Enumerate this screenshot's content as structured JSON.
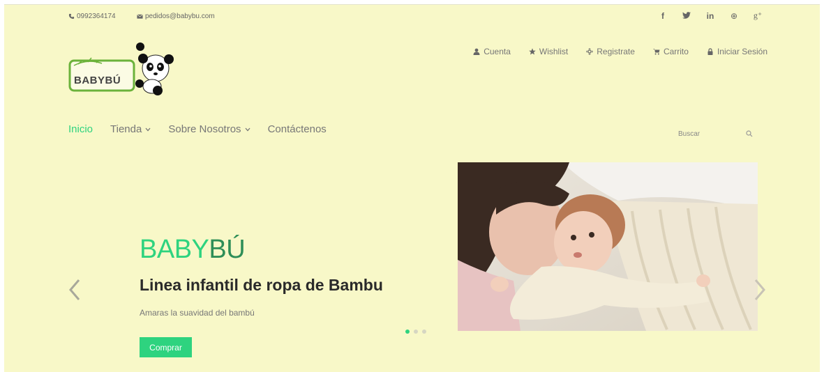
{
  "topbar": {
    "phone": "0992364174",
    "email": "pedidos@babybu.com",
    "social": [
      {
        "icon": "facebook-icon",
        "glyph": "f"
      },
      {
        "icon": "twitter-icon",
        "glyph": "➔"
      },
      {
        "icon": "linkedin-icon",
        "glyph": "in"
      },
      {
        "icon": "dribbble-icon",
        "glyph": "⊕"
      },
      {
        "icon": "google-plus-icon",
        "glyph": "g⁺"
      }
    ]
  },
  "logo": {
    "text": "BABYBÚ"
  },
  "account": {
    "cuenta": "Cuenta",
    "wishlist": "Wishlist",
    "registrate": "Registrate",
    "carrito": "Carrito",
    "login": "Iniciar Sesión"
  },
  "nav": {
    "inicio": "Inicio",
    "tienda": "Tienda",
    "nosotros": "Sobre Nosotros",
    "contacto": "Contáctenos"
  },
  "search": {
    "placeholder": "Buscar"
  },
  "slide": {
    "brand_green": "BABY",
    "brand_dark": "BÚ",
    "headline": "Linea infantil de ropa de Bambu",
    "subtitle": "Amaras la suavidad del bambú",
    "button": "Comprar",
    "dots": 3,
    "active_dot": 1
  },
  "colors": {
    "accent": "#2ed37f",
    "background": "#f8f8c8",
    "dark_green": "#2e8e57"
  }
}
